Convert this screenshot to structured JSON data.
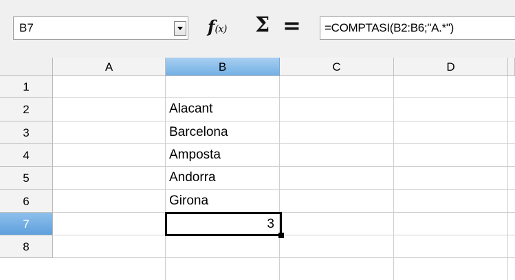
{
  "formula_bar": {
    "name_box_value": "B7",
    "function_wizard_icon": "fx-icon",
    "sum_icon": "sigma-icon",
    "formula_icon": "equals-icon",
    "formula": "=COMPTASI(B2:B6;\"A.*\")"
  },
  "columns": [
    "A",
    "B",
    "C",
    "D"
  ],
  "rows": [
    "1",
    "2",
    "3",
    "4",
    "5",
    "6",
    "7",
    "8"
  ],
  "cells": {
    "B2": "Alacant",
    "B3": "Barcelona",
    "B4": "Amposta",
    "B5": "Andorra",
    "B6": "Girona",
    "B7": "3"
  },
  "selection": {
    "active_cell": "B7",
    "active_column": "B",
    "active_row": "7"
  },
  "colors": {
    "header_selected": "#73b0e4",
    "grid_line": "#cfcfcf",
    "header_bg": "#f3f3f3"
  }
}
